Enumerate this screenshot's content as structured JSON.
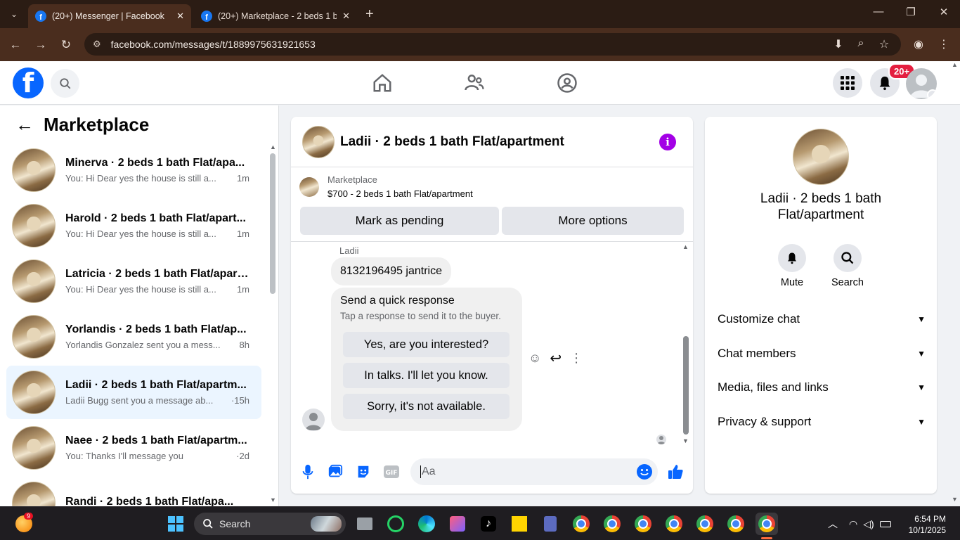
{
  "browser": {
    "tabs": [
      {
        "title": "(20+) Messenger | Facebook",
        "active": true
      },
      {
        "title": "(20+) Marketplace - 2 beds 1 b",
        "active": false
      }
    ],
    "url": "facebook.com/messages/t/1889975631921653"
  },
  "fb_header": {
    "notification_badge": "20+"
  },
  "sidebar": {
    "title": "Marketplace",
    "conversations": [
      {
        "name": "Minerva · 2 beds 1 bath Flat/apa...",
        "preview": "You: Hi Dear yes the house is still a...",
        "time": "1m"
      },
      {
        "name": "Harold · 2 beds 1 bath Flat/apart...",
        "preview": "You: Hi Dear yes the house is still a...",
        "time": "1m"
      },
      {
        "name": "Latricia · 2 beds 1 bath Flat/apart...",
        "preview": "You: Hi Dear yes the house is still a...",
        "time": "1m"
      },
      {
        "name": "Yorlandis · 2 beds 1 bath Flat/ap...",
        "preview": "Yorlandis Gonzalez sent you a mess...",
        "time": "8h"
      },
      {
        "name": "Ladii · 2 beds 1 bath Flat/apartm...",
        "preview": "Ladii Bugg sent you a message ab...",
        "time": "·15h",
        "selected": true
      },
      {
        "name": "Naee · 2 beds 1 bath Flat/apartm...",
        "preview": "You: Thanks I'll message you",
        "time": "·2d"
      },
      {
        "name": "Randi · 2 beds 1 bath Flat/apa...",
        "preview": "",
        "time": ""
      }
    ]
  },
  "chat": {
    "title": "Ladii · 2 beds 1 bath Flat/apartment",
    "listing_label": "Marketplace",
    "listing_price": "$700 - 2 beds 1 bath Flat/apartment",
    "mark_pending_label": "Mark as pending",
    "more_options_label": "More options",
    "sender": "Ladii",
    "message": "8132196495 jantrice",
    "quick_title": "Send a quick response",
    "quick_subtitle": "Tap a response to send it to the buyer.",
    "quick_responses": [
      "Yes, are you interested?",
      "In talks. I'll let you know.",
      "Sorry, it's not available."
    ],
    "composer_placeholder": "Aa"
  },
  "info_panel": {
    "title": "Ladii · 2 beds 1 bath Flat/apartment",
    "mute_label": "Mute",
    "search_label": "Search",
    "sections": [
      "Customize chat",
      "Chat members",
      "Media, files and links",
      "Privacy & support"
    ]
  },
  "taskbar": {
    "search_label": "Search",
    "time": "6:54 PM",
    "date": "10/1/2025",
    "notification_count": "9"
  },
  "colors": {
    "facebook_blue": "#0866ff",
    "info_purple": "#a300e6",
    "badge_red": "#e41e3f",
    "selected_row": "#ebf5ff"
  }
}
